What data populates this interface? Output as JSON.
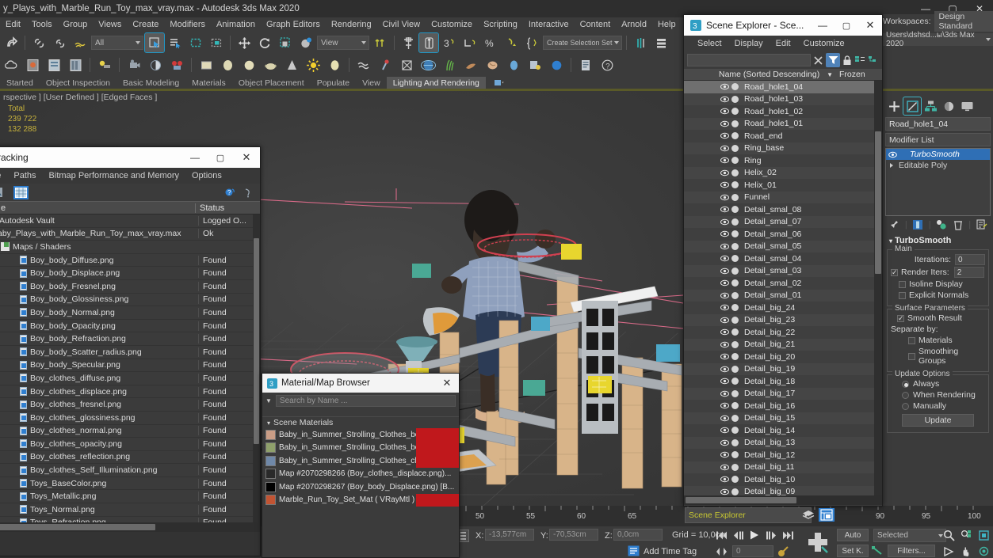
{
  "app": {
    "title": "y_Plays_with_Marble_Run_Toy_max_vray.max - Autodesk 3ds Max 2020",
    "min": "—",
    "max": "▢",
    "close": "✕"
  },
  "menubar": {
    "items": [
      "Edit",
      "Tools",
      "Group",
      "Views",
      "Create",
      "Modifiers",
      "Animation",
      "Graph Editors",
      "Rendering",
      "Civil View",
      "Customize",
      "Scripting",
      "Interactive",
      "Content",
      "Arnold",
      "Help"
    ]
  },
  "toolbar1": {
    "filter_value": "All",
    "ref_coord_value": "View",
    "selection_set_value": "Create Selection Set"
  },
  "ribbon": {
    "tabs": [
      "Started",
      "Object Inspection",
      "Basic Modeling",
      "Materials",
      "Object Placement",
      "Populate",
      "View",
      "Lighting And Rendering"
    ],
    "active": "Lighting And Rendering"
  },
  "viewport": {
    "label": "rspective ] [User Defined ] [Edged Faces ]",
    "stats_title": "Total",
    "stats_verts": "239 722",
    "stats_faces": "132 288"
  },
  "asset_tracking": {
    "title": "sset Tracking",
    "min": "—",
    "max": "▢",
    "close": "✕",
    "menu": [
      "r",
      "File",
      "Paths",
      "Bitmap Performance and Memory",
      "Options"
    ],
    "columns": [
      "e",
      "Status"
    ],
    "rows": [
      {
        "name": "Autodesk Vault",
        "status": "Logged O...",
        "icon": "vault"
      },
      {
        "name": "Baby_Plays_with_Marble_Run_Toy_max_vray.max",
        "status": "Ok",
        "icon": "max"
      },
      {
        "name": "Maps / Shaders",
        "status": "",
        "icon": "folder"
      },
      {
        "name": "Boy_body_Diffuse.png",
        "status": "Found",
        "icon": "png"
      },
      {
        "name": "Boy_body_Displace.png",
        "status": "Found",
        "icon": "png"
      },
      {
        "name": "Boy_body_Fresnel.png",
        "status": "Found",
        "icon": "png"
      },
      {
        "name": "Boy_body_Glossiness.png",
        "status": "Found",
        "icon": "png"
      },
      {
        "name": "Boy_body_Normal.png",
        "status": "Found",
        "icon": "png"
      },
      {
        "name": "Boy_body_Opacity.png",
        "status": "Found",
        "icon": "png"
      },
      {
        "name": "Boy_body_Refraction.png",
        "status": "Found",
        "icon": "png"
      },
      {
        "name": "Boy_body_Scatter_radius.png",
        "status": "Found",
        "icon": "png"
      },
      {
        "name": "Boy_body_Specular.png",
        "status": "Found",
        "icon": "png"
      },
      {
        "name": "Boy_clothes_diffuse.png",
        "status": "Found",
        "icon": "png"
      },
      {
        "name": "Boy_clothes_displace.png",
        "status": "Found",
        "icon": "png"
      },
      {
        "name": "Boy_clothes_fresnel.png",
        "status": "Found",
        "icon": "png"
      },
      {
        "name": "Boy_clothes_glossiness.png",
        "status": "Found",
        "icon": "png"
      },
      {
        "name": "Boy_clothes_normal.png",
        "status": "Found",
        "icon": "png"
      },
      {
        "name": "Boy_clothes_opacity.png",
        "status": "Found",
        "icon": "png"
      },
      {
        "name": "Boy_clothes_reflection.png",
        "status": "Found",
        "icon": "png"
      },
      {
        "name": "Boy_clothes_Self_Illumination.png",
        "status": "Found",
        "icon": "png"
      },
      {
        "name": "Toys_BaseColor.png",
        "status": "Found",
        "icon": "png"
      },
      {
        "name": "Toys_Metallic.png",
        "status": "Found",
        "icon": "png"
      },
      {
        "name": "Toys_Normal.png",
        "status": "Found",
        "icon": "png"
      },
      {
        "name": "Toys_Refraction.png",
        "status": "Found",
        "icon": "png"
      }
    ]
  },
  "material_browser": {
    "title": "Material/Map Browser",
    "close": "✕",
    "search_placeholder": "Search by Name ...",
    "group_label": "Scene Materials",
    "items": [
      {
        "label": "Baby_in_Summer_Strolling_Clothes_body_detail...",
        "swatch": "#c99d86",
        "tag": true
      },
      {
        "label": "Baby_in_Summer_Strolling_Clothes_body_MAT ...",
        "swatch": "#8fa06b",
        "tag": true
      },
      {
        "label": "Baby_in_Summer_Strolling_Clothes_clothes_MA...",
        "swatch": "#6f88a8",
        "tag": true
      },
      {
        "label": "Map  #2070298266  (Boy_clothes_displace.png)...",
        "swatch": "#2a2a2a",
        "tag": false
      },
      {
        "label": "Map  #2070298267  (Boy_body_Displace.png)   [B...",
        "swatch": "#000000",
        "tag": false
      },
      {
        "label": "Marble_Run_Toy_Set_Mat  ( VRayMtl )  [Ball_bl...",
        "swatch": "#c25433",
        "tag": true
      }
    ]
  },
  "scene_explorer": {
    "title": "Scene Explorer - Sce...",
    "min": "—",
    "max": "▢",
    "close": "✕",
    "menu": [
      "Select",
      "Display",
      "Edit",
      "Customize"
    ],
    "search_value": "",
    "col_name": "Name (Sorted Descending)",
    "col_frozen": "Frozen",
    "rows": [
      {
        "name": "Road_hole1_04",
        "selected": true
      },
      {
        "name": "Road_hole1_03",
        "selected": false
      },
      {
        "name": "Road_hole1_02",
        "selected": false
      },
      {
        "name": "Road_hole1_01",
        "selected": false
      },
      {
        "name": "Road_end",
        "selected": false
      },
      {
        "name": "Ring_base",
        "selected": false
      },
      {
        "name": "Ring",
        "selected": false
      },
      {
        "name": "Helix_02",
        "selected": false
      },
      {
        "name": "Helix_01",
        "selected": false
      },
      {
        "name": "Funnel",
        "selected": false
      },
      {
        "name": "Detail_smal_08",
        "selected": false
      },
      {
        "name": "Detail_smal_07",
        "selected": false
      },
      {
        "name": "Detail_smal_06",
        "selected": false
      },
      {
        "name": "Detail_smal_05",
        "selected": false
      },
      {
        "name": "Detail_smal_04",
        "selected": false
      },
      {
        "name": "Detail_smal_03",
        "selected": false
      },
      {
        "name": "Detail_smal_02",
        "selected": false
      },
      {
        "name": "Detail_smal_01",
        "selected": false
      },
      {
        "name": "Detail_big_24",
        "selected": false
      },
      {
        "name": "Detail_big_23",
        "selected": false
      },
      {
        "name": "Detail_big_22",
        "selected": false
      },
      {
        "name": "Detail_big_21",
        "selected": false
      },
      {
        "name": "Detail_big_20",
        "selected": false
      },
      {
        "name": "Detail_big_19",
        "selected": false
      },
      {
        "name": "Detail_big_18",
        "selected": false
      },
      {
        "name": "Detail_big_17",
        "selected": false
      },
      {
        "name": "Detail_big_16",
        "selected": false
      },
      {
        "name": "Detail_big_15",
        "selected": false
      },
      {
        "name": "Detail_big_14",
        "selected": false
      },
      {
        "name": "Detail_big_13",
        "selected": false
      },
      {
        "name": "Detail_big_12",
        "selected": false
      },
      {
        "name": "Detail_big_11",
        "selected": false
      },
      {
        "name": "Detail_big_10",
        "selected": false
      },
      {
        "name": "Detail_big_09",
        "selected": false
      }
    ],
    "dock_label": "Scene Explorer"
  },
  "command_panel": {
    "workspaces_label": "Workspaces:",
    "workspaces_value": "Design Standard",
    "path_value": "Users\\dshsd...ы\\3ds Max 2020",
    "object_name": "Road_hole1_04",
    "modifier_list_label": "Modifier List",
    "stack": [
      {
        "label": "TurboSmooth",
        "selected": true
      },
      {
        "label": "Editable Poly",
        "selected": false
      }
    ],
    "rollout_title": "TurboSmooth",
    "main_group": "Main",
    "iterations_label": "Iterations:",
    "iterations_value": "0",
    "render_iters_label": "Render Iters:",
    "render_iters_value": "2",
    "isoline_label": "Isoline Display",
    "explicit_normals_label": "Explicit Normals",
    "surface_group": "Surface Parameters",
    "smooth_result_label": "Smooth Result",
    "separate_by_label": "Separate by:",
    "materials_label": "Materials",
    "smoothing_groups_label": "Smoothing Groups",
    "update_group": "Update Options",
    "always_label": "Always",
    "when_rendering_label": "When Rendering",
    "manually_label": "Manually",
    "update_button": "Update"
  },
  "timeline": {
    "labels": [
      "50",
      "55",
      "60",
      "65",
      "90",
      "95",
      "100"
    ]
  },
  "statusbar": {
    "x_label": "X:",
    "x_value": "-13,577cm",
    "y_label": "Y:",
    "y_value": "-70,53cm",
    "z_label": "Z:",
    "z_value": "0,0cm",
    "grid_label": "Grid = 10,0cm",
    "add_time_tag": "Add Time Tag",
    "auto_key": "Auto",
    "set_key": "Set K.",
    "selected_value": "Selected",
    "filters_button": "Filters...",
    "frame_value": "0"
  },
  "colors": {
    "accent_blue": "#2f6fb5",
    "highlight": "#4f82b8",
    "yellow_text": "#c8b33c",
    "red_tag": "#c0181c"
  }
}
